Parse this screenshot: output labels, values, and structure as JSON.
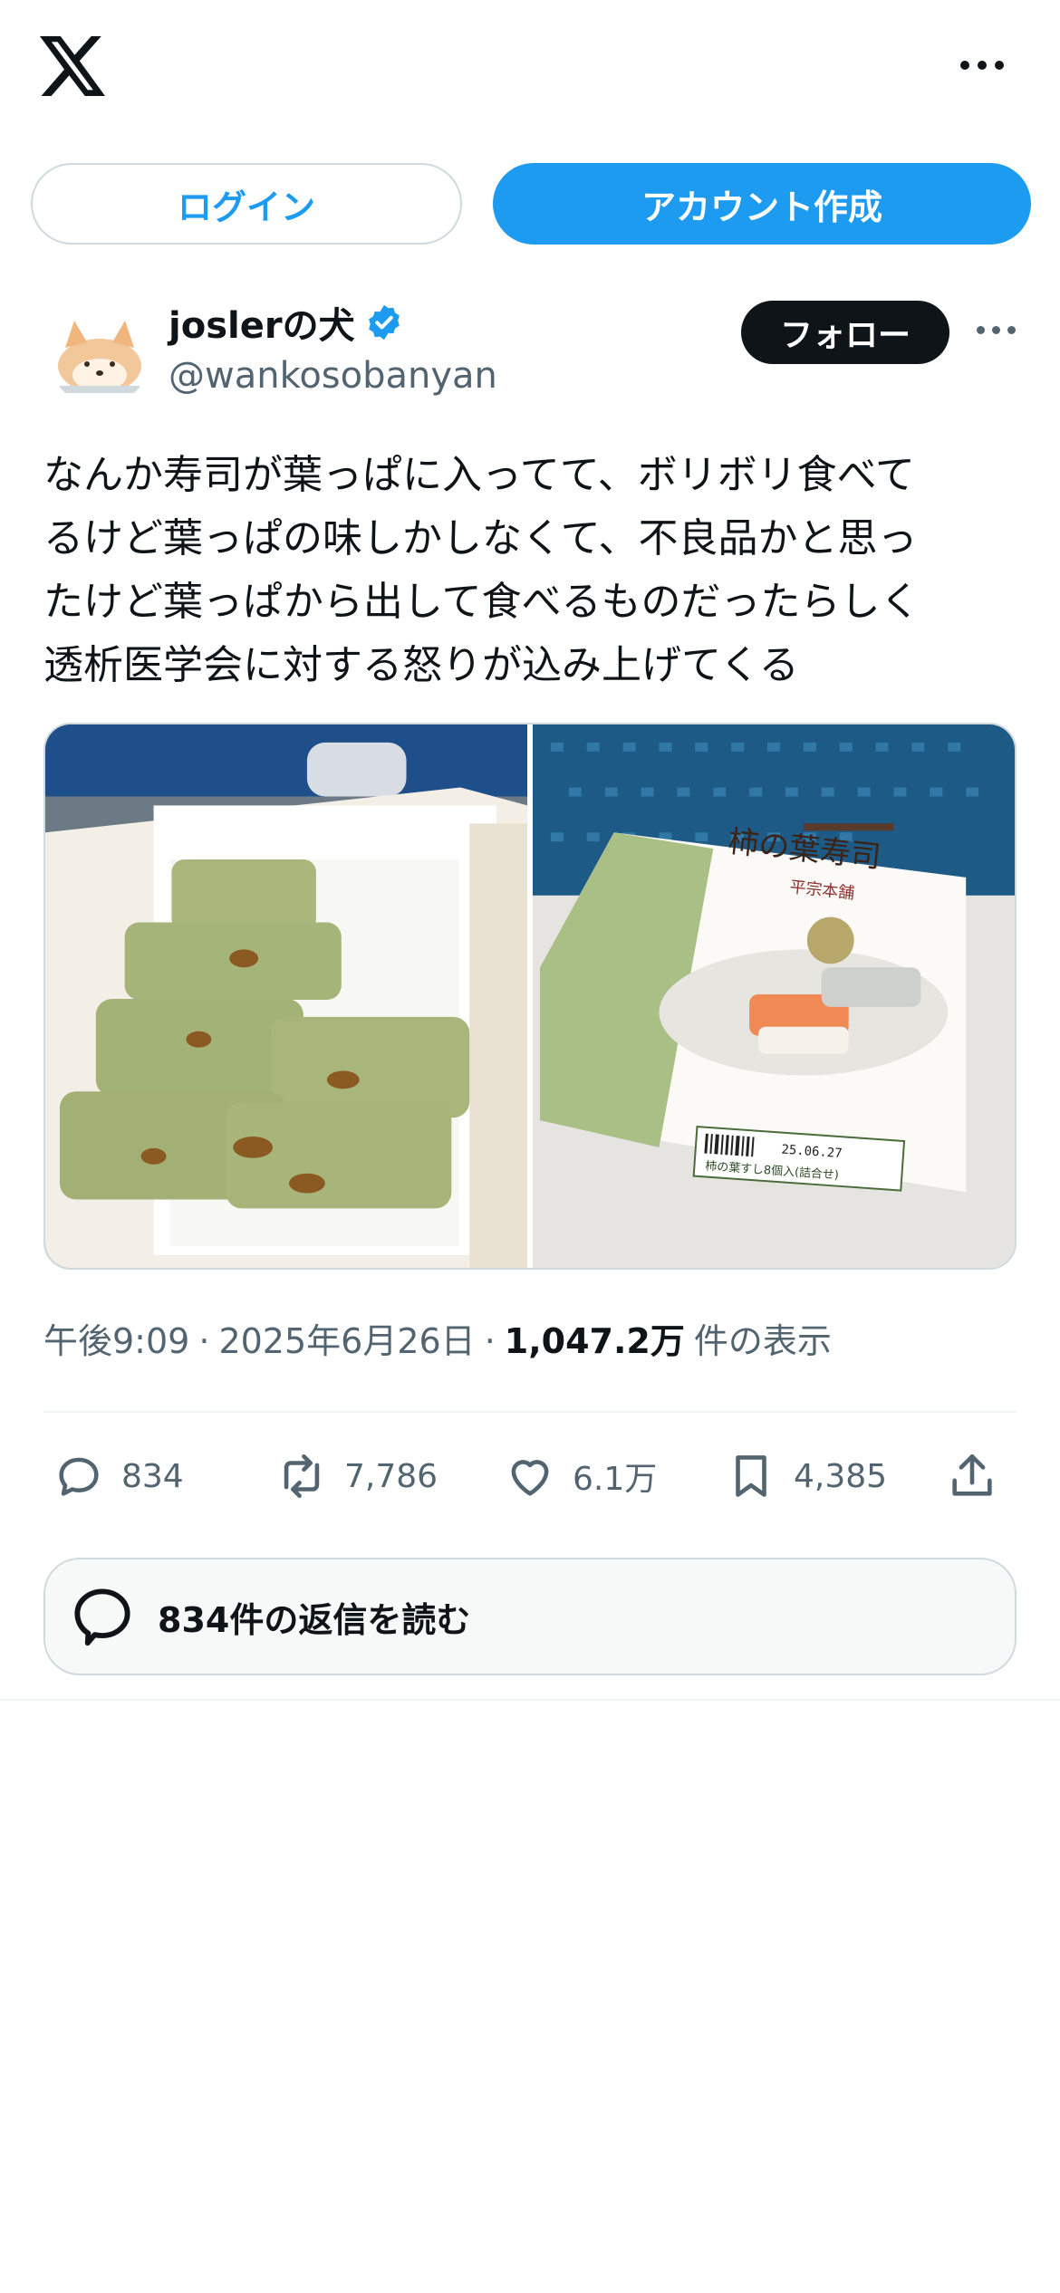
{
  "header": {
    "logo_icon": "x-logo",
    "more_icon": "more-horizontal-icon"
  },
  "auth": {
    "login_label": "ログイン",
    "signup_label": "アカウント作成"
  },
  "post": {
    "author": {
      "display_name": "joslerの犬",
      "handle": "@wankosobanyan",
      "verified": true
    },
    "follow_label": "フォロー",
    "text": "なんか寿司が葉っぱに入ってて、ボリボリ食べて\nるけど葉っぱの味しかしなくて、不良品かと思っ\nたけど葉っぱから出して食べるものだったらしく\n透析医学会に対する怒りが込み上げてくる",
    "images": [
      {
        "subject": "box of leaf-wrapped sushi"
      },
      {
        "subject": "sushi package label"
      }
    ],
    "package_label": {
      "brand": "柿の葉寿司",
      "maker": "平宗本舗",
      "date": "25.06.27",
      "product": "柿の葉すし8個入(詰合せ)"
    },
    "meta": {
      "time": "午後9:09",
      "separator": "·",
      "date": "2025年6月26日",
      "views_count": "1,047.2万",
      "views_label": "件の表示"
    },
    "stats": {
      "replies": "834",
      "reposts": "7,786",
      "likes": "6.1万",
      "bookmarks": "4,385"
    },
    "read_replies_label": "834件の返信を読む"
  },
  "colors": {
    "accent": "#1d9bf0",
    "text_primary": "#0f1419",
    "text_secondary": "#536471",
    "border": "#cfd9de"
  }
}
